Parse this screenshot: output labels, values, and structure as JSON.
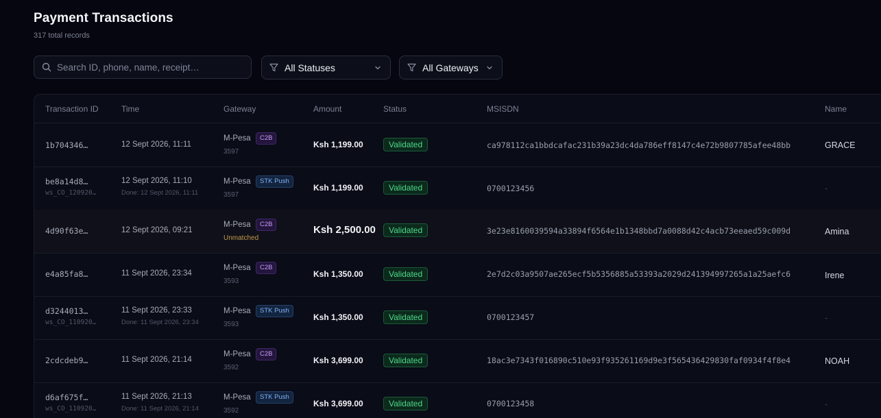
{
  "header": {
    "title": "Payment Transactions",
    "subtitle": "317 total records"
  },
  "filters": {
    "search_placeholder": "Search ID, phone, name, receipt…",
    "search_value": "",
    "status_label": "All Statuses",
    "gateway_label": "All Gateways"
  },
  "table": {
    "columns": [
      "Transaction ID",
      "Time",
      "Gateway",
      "Amount",
      "Status",
      "MSISDN",
      "Name"
    ],
    "rows": [
      {
        "id": "1b704346…",
        "sub_id": "",
        "time": "12 Sept 2026, 11:11",
        "done": "",
        "gateway": "M-Pesa",
        "tag": "C2B",
        "gateway_sub": "3597",
        "amount": "Ksh 1,199.00",
        "status": "Validated",
        "msisdn": "ca978112ca1bbdcafac231b39a23dc4da786eff8147c4e72b9807785afee48bb",
        "name": "GRACE"
      },
      {
        "id": "be8a14d8…",
        "sub_id": "ws_CO_120920…",
        "time": "12 Sept 2026, 11:10",
        "done": "Done: 12 Sept 2026, 11:11",
        "gateway": "M-Pesa",
        "tag": "STK Push",
        "gateway_sub": "3597",
        "amount": "Ksh 1,199.00",
        "status": "Validated",
        "msisdn": "0700123456",
        "name": "-"
      },
      {
        "id": "4d90f63e…",
        "sub_id": "",
        "time": "12 Sept 2026, 09:21",
        "done": "",
        "gateway": "M-Pesa",
        "tag": "C2B",
        "gateway_sub": "Unmatched",
        "amount": "Ksh 2,500.00",
        "status": "Validated",
        "msisdn": "3e23e8160039594a33894f6564e1b1348bbd7a0088d42c4acb73eeaed59c009d",
        "name": "Amina"
      },
      {
        "id": "e4a85fa8…",
        "sub_id": "",
        "time": "11 Sept 2026, 23:34",
        "done": "",
        "gateway": "M-Pesa",
        "tag": "C2B",
        "gateway_sub": "3593",
        "amount": "Ksh 1,350.00",
        "status": "Validated",
        "msisdn": "2e7d2c03a9507ae265ecf5b5356885a53393a2029d241394997265a1a25aefc6",
        "name": "Irene"
      },
      {
        "id": "d3244013…",
        "sub_id": "ws_CO_110920…",
        "time": "11 Sept 2026, 23:33",
        "done": "Done: 11 Sept 2026, 23:34",
        "gateway": "M-Pesa",
        "tag": "STK Push",
        "gateway_sub": "3593",
        "amount": "Ksh 1,350.00",
        "status": "Validated",
        "msisdn": "0700123457",
        "name": "-"
      },
      {
        "id": "2cdcdeb9…",
        "sub_id": "",
        "time": "11 Sept 2026, 21:14",
        "done": "",
        "gateway": "M-Pesa",
        "tag": "C2B",
        "gateway_sub": "3592",
        "amount": "Ksh 3,699.00",
        "status": "Validated",
        "msisdn": "18ac3e7343f016890c510e93f935261169d9e3f565436429830faf0934f4f8e4",
        "name": "NOAH"
      },
      {
        "id": "d6af675f…",
        "sub_id": "ws_CO_110920…",
        "time": "11 Sept 2026, 21:13",
        "done": "Done: 11 Sept 2026, 21:14",
        "gateway": "M-Pesa",
        "tag": "STK Push",
        "gateway_sub": "3592",
        "amount": "Ksh 3,699.00",
        "status": "Validated",
        "msisdn": "0700123458",
        "name": "-"
      }
    ]
  },
  "colors": {
    "background": "#05060f",
    "validated": "#4ed88a",
    "c2b_tag": "#c59cf5",
    "stk_tag": "#7fb0f3",
    "unmatched": "#c39a4a"
  },
  "icons": {
    "search": "search-icon",
    "filter": "funnel-icon",
    "dropdown": "chevron-down-icon"
  }
}
